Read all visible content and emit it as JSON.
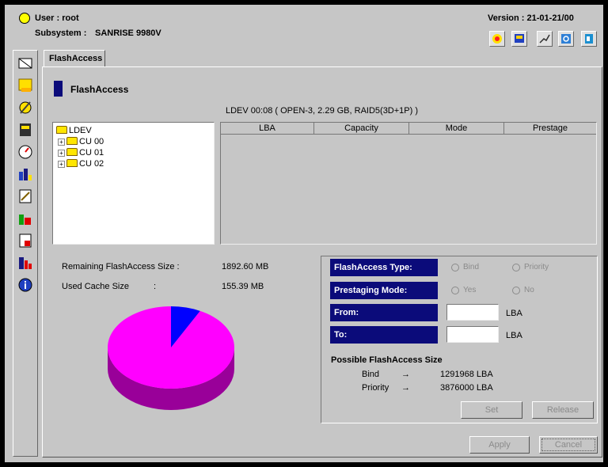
{
  "header": {
    "user_label": "User : root",
    "subsystem_label": "Subsystem :",
    "subsystem_value": "SANRISE 9980V",
    "version_label": "Version : 21-01-21/00",
    "toolbar_icons": [
      "status-icon",
      "display-icon",
      "chart-icon",
      "refresh-icon",
      "exit-icon"
    ]
  },
  "sidebar": {
    "icons": [
      "ldev-icon",
      "storage-icon",
      "settings-icon",
      "database-icon",
      "gauge-icon",
      "bar-chart-icon",
      "report-icon",
      "pie-chart-icon",
      "tools-icon",
      "monitor-icon",
      "info-icon"
    ]
  },
  "tabs": [
    {
      "label": "FlashAccess"
    }
  ],
  "main": {
    "title": "FlashAccess",
    "ldev_info": "LDEV 00:08 ( OPEN-3, 2.29 GB, RAID5(3D+1P) )",
    "tree": {
      "root": "LDEV",
      "children": [
        "CU 00",
        "CU 01",
        "CU 02"
      ]
    },
    "table": {
      "columns": [
        "LBA",
        "Capacity",
        "Mode",
        "Prestage"
      ]
    },
    "remaining_label": "Remaining FlashAccess Size :",
    "remaining_value": "1892.60 MB",
    "used_label": "Used Cache Size",
    "used_colon": ":",
    "used_value": "155.39 MB",
    "pie": {
      "used_fraction": 0.076,
      "colors": {
        "remaining": "#ff00ff",
        "remaining_side": "#990099",
        "used": "#0000ff"
      }
    }
  },
  "settings": {
    "type_label": "FlashAccess Type:",
    "type_options": [
      "Bind",
      "Priority"
    ],
    "prestage_label": "Prestaging Mode:",
    "prestage_options": [
      "Yes",
      "No"
    ],
    "from_label": "From:",
    "from_value": "",
    "from_unit": "LBA",
    "to_label": "To:",
    "to_value": "",
    "to_unit": "LBA",
    "possible_title": "Possible FlashAccess Size",
    "possible": [
      {
        "name": "Bind",
        "arrow": "→",
        "value": "1291968 LBA"
      },
      {
        "name": "Priority",
        "arrow": "→",
        "value": "3876000 LBA"
      }
    ],
    "set_button": "Set",
    "release_button": "Release"
  },
  "footer": {
    "apply_button": "Apply",
    "cancel_button": "Cancel"
  }
}
